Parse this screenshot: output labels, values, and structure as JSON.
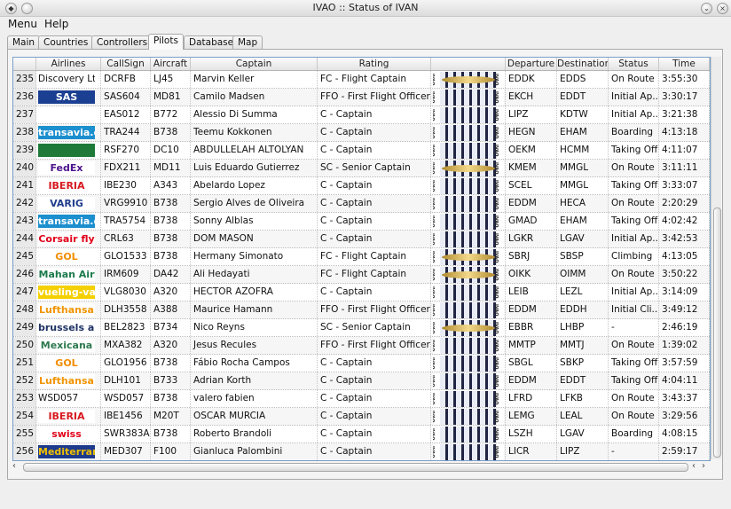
{
  "window": {
    "title": "IVAO :: Status of IVAN"
  },
  "menu": [
    "Menu",
    "Help"
  ],
  "tabs": [
    "Main",
    "Countries",
    "Controllers",
    "Pilots",
    "Database",
    "Map"
  ],
  "active_tab": "Pilots",
  "columns": [
    "",
    "Airlines",
    "CallSign",
    "Aircraft",
    "Captain",
    "Rating",
    "",
    "Departure",
    "Destination",
    "Status",
    "Time"
  ],
  "rating_image_side_text": "IVAO",
  "rows": [
    {
      "n": "235",
      "airline": "Discovery Ltd",
      "logo": "plain",
      "callsign": "DCRFB",
      "aircraft": "LJ45",
      "captain": "Marvin Keller",
      "rating": "FC - Flight Captain",
      "badge": "wings",
      "dep": "EDDK",
      "dest": "EDDS",
      "status": "On Route",
      "time": "3:55:30"
    },
    {
      "n": "236",
      "airline": "SAS",
      "logo": "sas",
      "callsign": "SAS604",
      "aircraft": "MD81",
      "captain": "Camilo Madsen",
      "rating": "FFO - First Flight Officer",
      "badge": "bars",
      "dep": "EKCH",
      "dest": "EDDT",
      "status": "Initial Ap...",
      "time": "3:30:17"
    },
    {
      "n": "237",
      "airline": "",
      "logo": "plane",
      "callsign": "EAS012",
      "aircraft": "B772",
      "captain": "Alessio Di Summa",
      "rating": "C - Captain",
      "badge": "bars",
      "dep": "LIPZ",
      "dest": "KDTW",
      "status": "Initial Ap...",
      "time": "3:21:38"
    },
    {
      "n": "238",
      "airline": "transavia.com",
      "logo": "transavia",
      "callsign": "TRA244",
      "aircraft": "B738",
      "captain": "Teemu Kokkonen",
      "rating": "C - Captain",
      "badge": "bars",
      "dep": "HEGN",
      "dest": "EHAM",
      "status": "Boarding",
      "time": "4:13:18"
    },
    {
      "n": "239",
      "airline": "",
      "logo": "saudia",
      "callsign": "RSF270",
      "aircraft": "DC10",
      "captain": "ABDULLELAH ALTOLYAN",
      "rating": "C - Captain",
      "badge": "bars",
      "dep": "OEKM",
      "dest": "HCMM",
      "status": "Taking Off",
      "time": "4:11:07"
    },
    {
      "n": "240",
      "airline": "FedEx",
      "logo": "fedex",
      "callsign": "FDX211",
      "aircraft": "MD11",
      "captain": "Luis Eduardo Gutierrez",
      "rating": "SC - Senior Captain",
      "badge": "wings",
      "dep": "KMEM",
      "dest": "MMGL",
      "status": "On Route",
      "time": "3:11:11"
    },
    {
      "n": "241",
      "airline": "IBERIA",
      "logo": "iberia",
      "callsign": "IBE230",
      "aircraft": "A343",
      "captain": "Abelardo Lopez",
      "rating": "C - Captain",
      "badge": "bars",
      "dep": "SCEL",
      "dest": "MMGL",
      "status": "Taking Off",
      "time": "3:33:07"
    },
    {
      "n": "242",
      "airline": "VARIG",
      "logo": "varig",
      "callsign": "VRG9910",
      "aircraft": "B738",
      "captain": "Sergio Alves de Oliveira",
      "rating": "C - Captain",
      "badge": "bars",
      "dep": "EDDM",
      "dest": "HECA",
      "status": "On Route",
      "time": "2:20:29"
    },
    {
      "n": "243",
      "airline": "transavia.com",
      "logo": "transavia",
      "callsign": "TRA5754",
      "aircraft": "B738",
      "captain": "Sonny Alblas",
      "rating": "C - Captain",
      "badge": "bars",
      "dep": "GMAD",
      "dest": "EHAM",
      "status": "Taking Off",
      "time": "4:02:42"
    },
    {
      "n": "244",
      "airline": "Corsair fly",
      "logo": "corsair",
      "callsign": "CRL63",
      "aircraft": "B738",
      "captain": "DOM MASON",
      "rating": "C - Captain",
      "badge": "bars",
      "dep": "LGKR",
      "dest": "LGAV",
      "status": "Initial Ap...",
      "time": "3:42:53"
    },
    {
      "n": "245",
      "airline": "GOL",
      "logo": "gol",
      "callsign": "GLO1533",
      "aircraft": "B738",
      "captain": "Hermany Simonato",
      "rating": "FC - Flight Captain",
      "badge": "wings",
      "dep": "SBRJ",
      "dest": "SBSP",
      "status": "Climbing",
      "time": "4:13:05"
    },
    {
      "n": "246",
      "airline": "Mahan Air",
      "logo": "mahan",
      "callsign": "IRM609",
      "aircraft": "DA42",
      "captain": "Ali Hedayati",
      "rating": "FC - Flight Captain",
      "badge": "wings",
      "dep": "OIKK",
      "dest": "OIMM",
      "status": "On Route",
      "time": "3:50:22"
    },
    {
      "n": "247",
      "airline": "vueling-va.com",
      "logo": "vueling",
      "callsign": "VLG8030",
      "aircraft": "A320",
      "captain": "HECTOR AZOFRA",
      "rating": "C - Captain",
      "badge": "bars",
      "dep": "LEIB",
      "dest": "LEZL",
      "status": "Initial Ap...",
      "time": "3:14:09"
    },
    {
      "n": "248",
      "airline": "Lufthansa",
      "logo": "lufthansa",
      "callsign": "DLH3558",
      "aircraft": "A388",
      "captain": "Maurice Hamann",
      "rating": "FFO - First Flight Officer",
      "badge": "bars",
      "dep": "EDDM",
      "dest": "EDDH",
      "status": "Initial Cli...",
      "time": "3:49:12"
    },
    {
      "n": "249",
      "airline": "brussels airlines",
      "logo": "brussels",
      "callsign": "BEL2823",
      "aircraft": "B734",
      "captain": "Nico Reyns",
      "rating": "SC - Senior Captain",
      "badge": "wings",
      "dep": "EBBR",
      "dest": "LHBP",
      "status": "-",
      "time": "2:46:19"
    },
    {
      "n": "250",
      "airline": "Mexicana",
      "logo": "mexicana",
      "callsign": "MXA382",
      "aircraft": "A320",
      "captain": "Jesus Recules",
      "rating": "FFO - First Flight Officer",
      "badge": "bars",
      "dep": "MMTP",
      "dest": "MMTJ",
      "status": "On Route",
      "time": "1:39:02"
    },
    {
      "n": "251",
      "airline": "GOL",
      "logo": "gol",
      "callsign": "GLO1956",
      "aircraft": "B738",
      "captain": "Fábio Rocha Campos",
      "rating": "C - Captain",
      "badge": "bars",
      "dep": "SBGL",
      "dest": "SBKP",
      "status": "Taking Off",
      "time": "3:57:59"
    },
    {
      "n": "252",
      "airline": "Lufthansa",
      "logo": "lufthansa",
      "callsign": "DLH101",
      "aircraft": "B733",
      "captain": "Adrian Korth",
      "rating": "C - Captain",
      "badge": "bars",
      "dep": "EDDM",
      "dest": "EDDT",
      "status": "Taking Off",
      "time": "4:04:11"
    },
    {
      "n": "253",
      "airline": "WSD057",
      "logo": "plain",
      "callsign": "WSD057",
      "aircraft": "B738",
      "captain": "valero fabien",
      "rating": "C - Captain",
      "badge": "bars",
      "dep": "LFRD",
      "dest": "LFKB",
      "status": "On Route",
      "time": "3:43:37"
    },
    {
      "n": "254",
      "airline": "IBERIA",
      "logo": "iberia",
      "callsign": "IBE1456",
      "aircraft": "M20T",
      "captain": "OSCAR MURCIA",
      "rating": "C - Captain",
      "badge": "bars",
      "dep": "LEMG",
      "dest": "LEAL",
      "status": "On Route",
      "time": "3:29:56"
    },
    {
      "n": "255",
      "airline": "swiss",
      "logo": "swiss",
      "callsign": "SWR383A",
      "aircraft": "B738",
      "captain": "Roberto Brandoli",
      "rating": "C - Captain",
      "badge": "bars",
      "dep": "LSZH",
      "dest": "LGAV",
      "status": "Boarding",
      "time": "4:08:15"
    },
    {
      "n": "256",
      "airline": "Mediterranea",
      "logo": "mediterranea",
      "callsign": "MED307",
      "aircraft": "F100",
      "captain": "Gianluca Palombini",
      "rating": "C - Captain",
      "badge": "bars",
      "dep": "LICR",
      "dest": "LIPZ",
      "status": "-",
      "time": "2:59:17"
    }
  ],
  "logo_styles": {
    "plain": {
      "bg": "transparent",
      "fg": "#111"
    },
    "sas": {
      "bg": "#1b3f91",
      "fg": "#ffffff"
    },
    "plane": {
      "bg": "#ffffff",
      "fg": "#d52b1e"
    },
    "transavia": {
      "bg": "#1c8fcf",
      "fg": "#ffffff"
    },
    "saudia": {
      "bg": "#1f7a3a",
      "fg": "#ffffff"
    },
    "fedex": {
      "bg": "#ffffff",
      "fg": "#4d148c"
    },
    "iberia": {
      "bg": "#ffffff",
      "fg": "#d71920"
    },
    "varig": {
      "bg": "#ffffff",
      "fg": "#1e3d8c"
    },
    "corsair": {
      "bg": "#ffffff",
      "fg": "#e2001a"
    },
    "gol": {
      "bg": "#ffffff",
      "fg": "#f28c00"
    },
    "mahan": {
      "bg": "#ffffff",
      "fg": "#1b7a4a"
    },
    "vueling": {
      "bg": "#f5d000",
      "fg": "#ffffff"
    },
    "lufthansa": {
      "bg": "#ffffff",
      "fg": "#f29400"
    },
    "brussels": {
      "bg": "#ffffff",
      "fg": "#1e3264"
    },
    "mexicana": {
      "bg": "#ffffff",
      "fg": "#2d7a4e"
    },
    "swiss": {
      "bg": "#ffffff",
      "fg": "#e2001a"
    },
    "mediterranea": {
      "bg": "#1e3a8c",
      "fg": "#f0c000"
    }
  }
}
